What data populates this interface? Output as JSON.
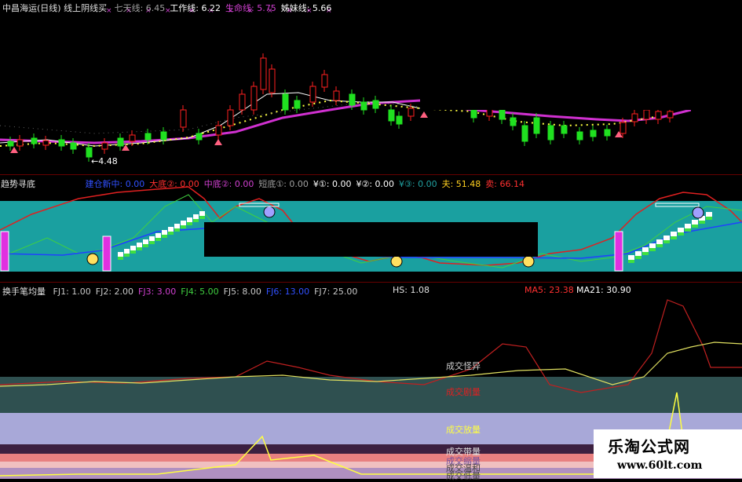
{
  "panel1": {
    "title": "中昌海运(日线) 线上阴线买",
    "items": [
      {
        "label": "七天线:",
        "value": "6.45",
        "color": "#a0a0a0"
      },
      {
        "label": "工作线:",
        "value": "6.22",
        "color": "#ffffff"
      },
      {
        "label": "生命线:",
        "value": "5.75",
        "color": "#d040d0"
      },
      {
        "label": "姊妹线:",
        "value": "5.66",
        "color": "#ffffff"
      }
    ],
    "low_marker": "4.48"
  },
  "panel2": {
    "title": "趋势寻底",
    "items": [
      {
        "label": "建仓新中:",
        "value": "0.00",
        "color": "#3050ff"
      },
      {
        "label": "大底②:",
        "value": "0.00",
        "color": "#ff3030"
      },
      {
        "label": "中底②:",
        "value": "0.00",
        "color": "#d040d0"
      },
      {
        "label": "短底①:",
        "value": "0.00",
        "color": "#a0a0a0"
      },
      {
        "label": "¥①:",
        "value": "0.00",
        "color": "#ffffff"
      },
      {
        "label": "¥②:",
        "value": "0.00",
        "color": "#ffffff"
      },
      {
        "label": "¥③:",
        "value": "0.00",
        "color": "#20a0a0"
      },
      {
        "label": "夫:",
        "value": "51.48",
        "color": "#ffd020"
      },
      {
        "label": "卖:",
        "value": "66.14",
        "color": "#ff3030"
      }
    ]
  },
  "panel3": {
    "title": "换手笔均量",
    "items": [
      {
        "label": "FJ1:",
        "value": "1.00",
        "color": "#c8c8c8"
      },
      {
        "label": "FJ2:",
        "value": "2.00",
        "color": "#c8c8c8"
      },
      {
        "label": "FJ3:",
        "value": "3.00",
        "color": "#d040d0"
      },
      {
        "label": "FJ4:",
        "value": "5.00",
        "color": "#40d040"
      },
      {
        "label": "FJ5:",
        "value": "8.00",
        "color": "#c8c8c8"
      },
      {
        "label": "FJ6:",
        "value": "13.00",
        "color": "#3050ff"
      },
      {
        "label": "FJ7:",
        "value": "25.00",
        "color": "#c8c8c8"
      }
    ],
    "hs": {
      "label": "HS:",
      "value": "1.08"
    },
    "ma5": {
      "label": "MA5:",
      "value": "23.38"
    },
    "ma21": {
      "label": "MA21:",
      "value": "30.90"
    },
    "bands": {
      "b1": "成交怪异",
      "b2": "成交剧量",
      "b3": "成交放量",
      "b4": "成交带量",
      "b5": "成交缩量",
      "b6": "成交温和",
      "b7": "成交低量"
    }
  },
  "watermark": {
    "name": "乐淘公式网",
    "url": "www.60lt.com"
  }
}
